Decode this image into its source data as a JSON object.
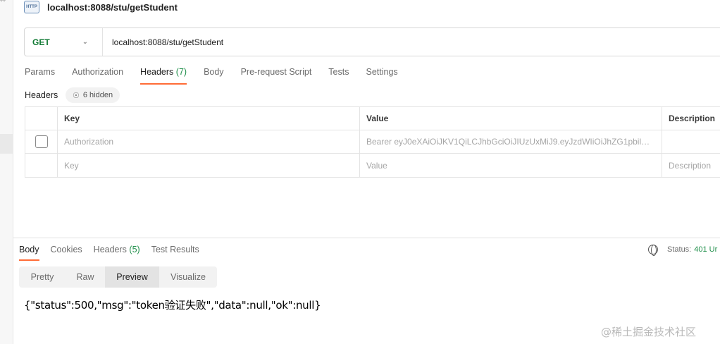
{
  "request": {
    "title": "localhost:8088/stu/getStudent",
    "method": "GET",
    "url": "localhost:8088/stu/getStudent",
    "http_icon_label": "HTTP"
  },
  "request_tabs": [
    {
      "label": "Params"
    },
    {
      "label": "Authorization"
    },
    {
      "label": "Headers",
      "count": "(7)",
      "active": true
    },
    {
      "label": "Body"
    },
    {
      "label": "Pre-request Script"
    },
    {
      "label": "Tests"
    },
    {
      "label": "Settings"
    }
  ],
  "headers_section": {
    "label": "Headers",
    "hidden_label": "6 hidden",
    "columns": {
      "key": "Key",
      "value": "Value",
      "description": "Description"
    },
    "rows": [
      {
        "key": "Authorization",
        "value": "Bearer eyJ0eXAiOiJKV1QiLCJhbGciOiJIUzUxMiJ9.eyJzdWIiOiJhZG1pbil…",
        "description": ""
      }
    ],
    "placeholder": {
      "key": "Key",
      "value": "Value",
      "description": "Description"
    }
  },
  "response_tabs": [
    {
      "label": "Body",
      "active": true
    },
    {
      "label": "Cookies"
    },
    {
      "label": "Headers",
      "count": "(5)"
    },
    {
      "label": "Test Results"
    }
  ],
  "status": {
    "label": "Status:",
    "value": "401 Ur"
  },
  "view_modes": [
    {
      "label": "Pretty"
    },
    {
      "label": "Raw"
    },
    {
      "label": "Preview",
      "active": true
    },
    {
      "label": "Visualize"
    }
  ],
  "response_body": "{\"status\":500,\"msg\":\"token验证失败\",\"data\":null,\"ok\":null}",
  "watermark": "@稀土掘金技术社区",
  "colors": {
    "accent": "#ff6c37",
    "method": "#117a34",
    "count": "#1f8f4a"
  }
}
